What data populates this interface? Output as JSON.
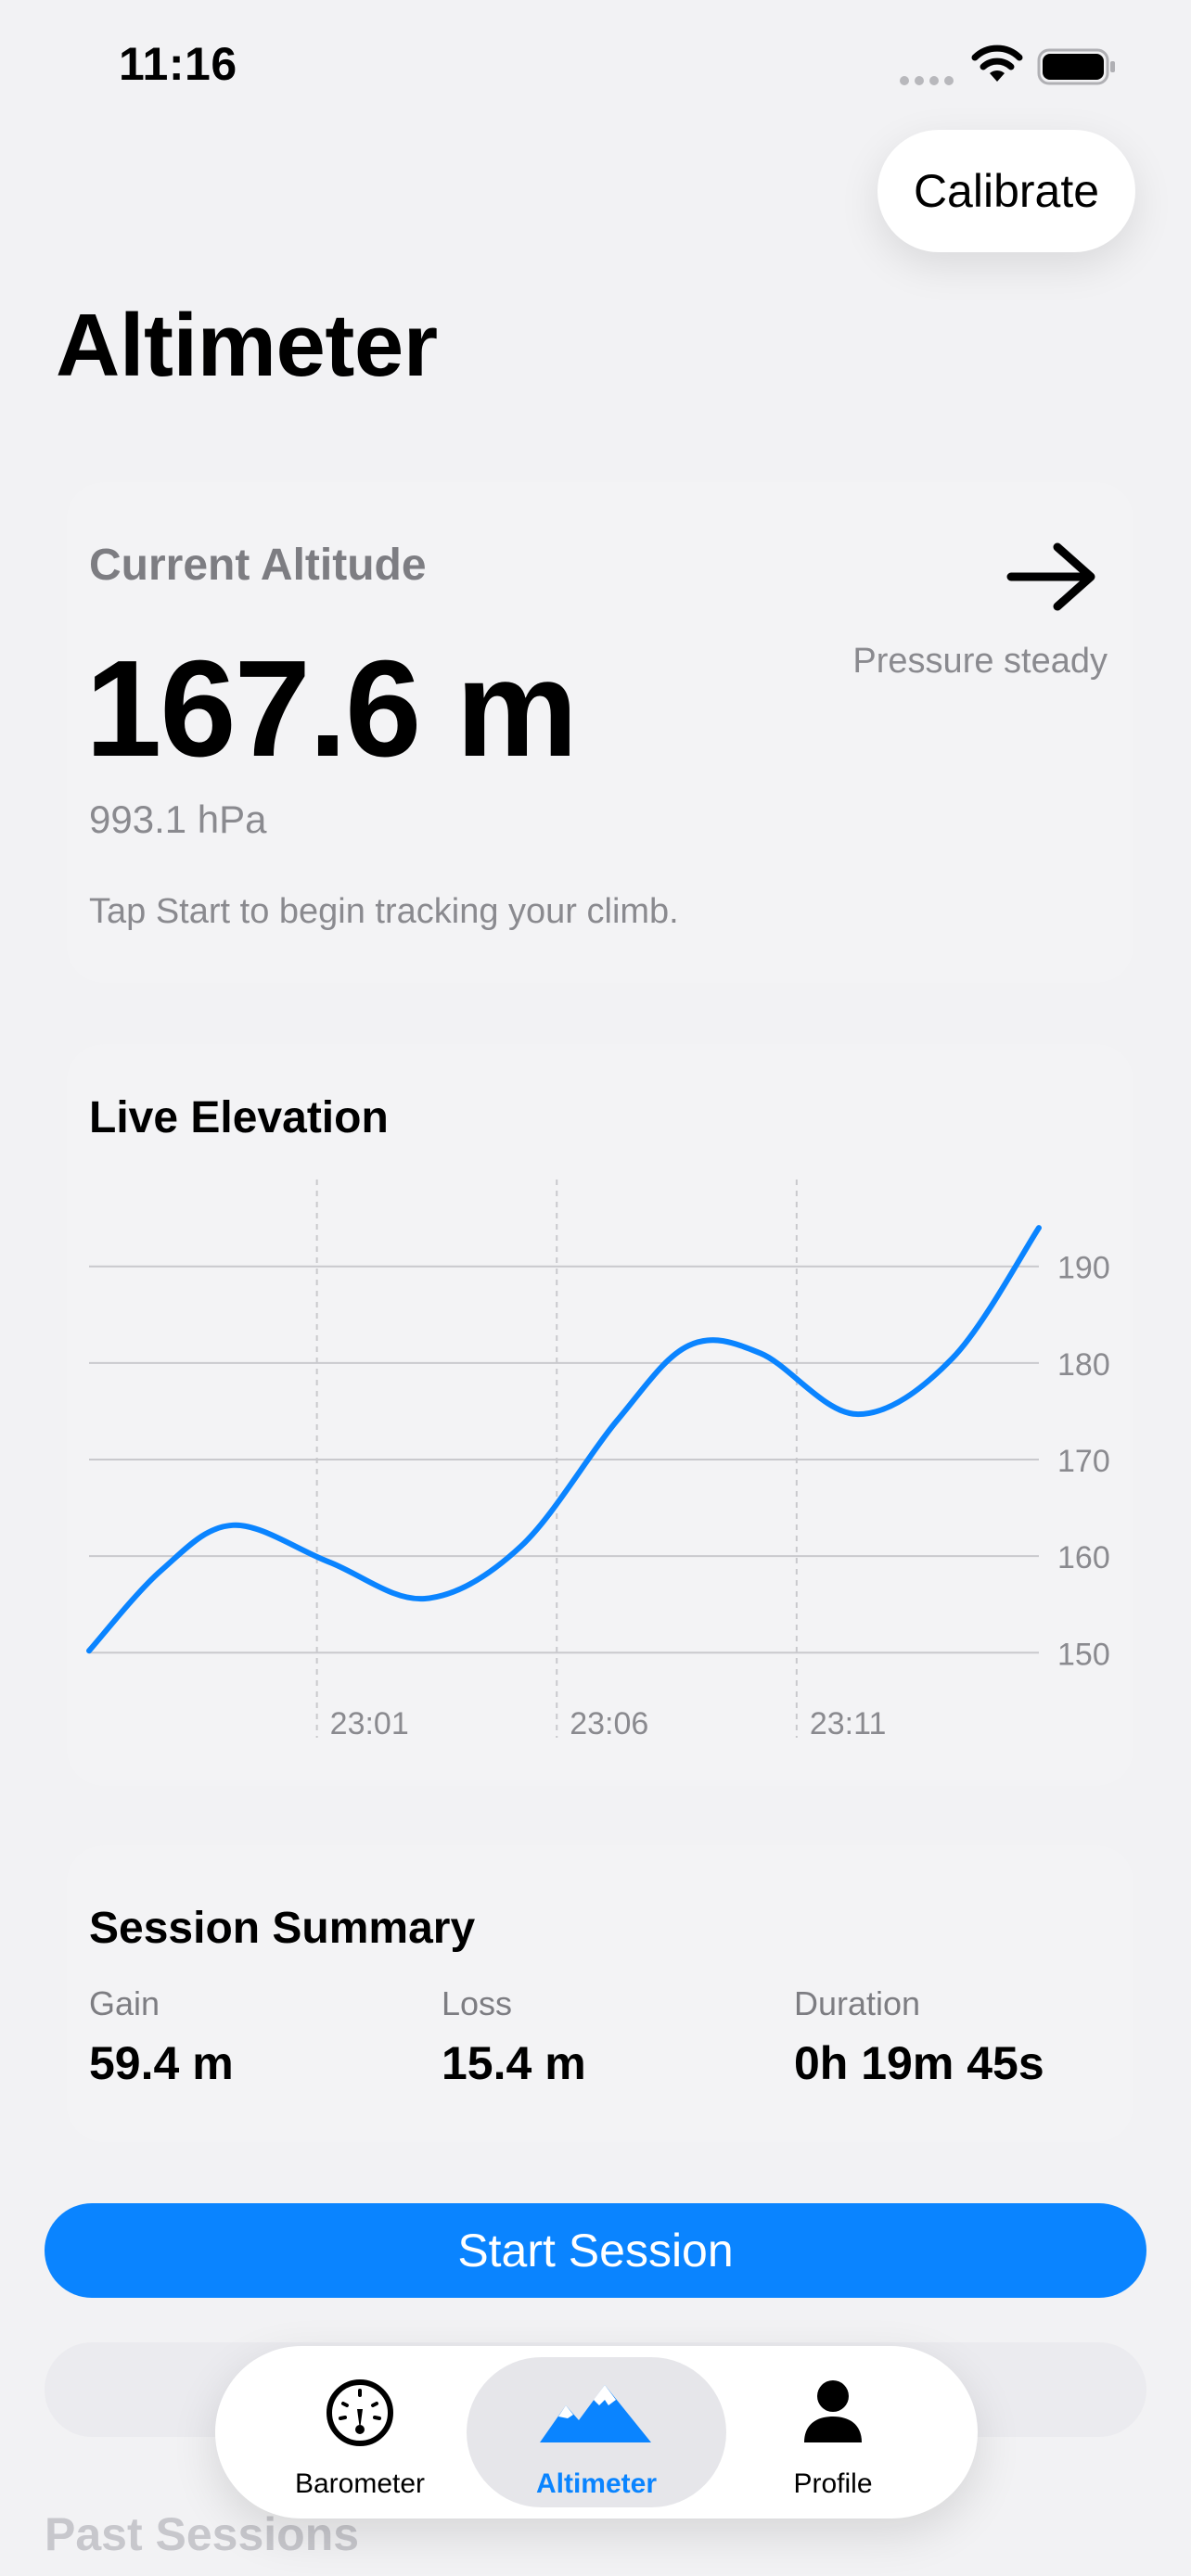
{
  "status": {
    "time": "11:16"
  },
  "header": {
    "calibrate_label": "Calibrate",
    "title": "Altimeter"
  },
  "altitude_card": {
    "label": "Current Altitude",
    "value": "167.6 m",
    "pressure": "993.1 hPa",
    "hint": "Tap Start to begin tracking your climb.",
    "trend_text": "Pressure steady",
    "trend_icon": "arrow-right-icon"
  },
  "chart_card": {
    "title": "Live Elevation"
  },
  "chart_data": {
    "type": "line",
    "title": "Live Elevation",
    "x_tick_labels": [
      "23:01",
      "23:06",
      "23:11"
    ],
    "y_ticks": [
      150,
      160,
      170,
      180,
      190
    ],
    "ylim": [
      141,
      199
    ],
    "xlim": [
      0,
      19.8
    ],
    "grid": true,
    "y_axis_position": "right",
    "series": [
      {
        "color": "#0a84ff",
        "x": [
          0,
          1.5,
          3,
          5,
          7,
          9,
          11,
          12.5,
          14,
          16,
          18,
          19.8
        ],
        "y": [
          150.2,
          158.5,
          163.2,
          159.4,
          155.6,
          161.0,
          174.0,
          181.8,
          181.0,
          174.7,
          180.5,
          194.0
        ]
      }
    ],
    "x_tick_positions": [
      4.75,
      9.75,
      14.75
    ]
  },
  "summary": {
    "title": "Session Summary",
    "stats": [
      {
        "label": "Gain",
        "value": "59.4 m"
      },
      {
        "label": "Loss",
        "value": "15.4 m"
      },
      {
        "label": "Duration",
        "value": "0h 19m 45s"
      }
    ]
  },
  "actions": {
    "start_label": "Start Session"
  },
  "past_sessions": {
    "title": "Past Sessions"
  },
  "tabbar": {
    "tabs": [
      {
        "label": "Barometer",
        "icon": "gauge-icon",
        "active": false
      },
      {
        "label": "Altimeter",
        "icon": "mountains-icon",
        "active": true
      },
      {
        "label": "Profile",
        "icon": "person-icon",
        "active": false
      }
    ]
  },
  "colors": {
    "accent": "#0a84ff",
    "background": "#f2f2f4",
    "secondary_text": "#8a8a8f"
  }
}
